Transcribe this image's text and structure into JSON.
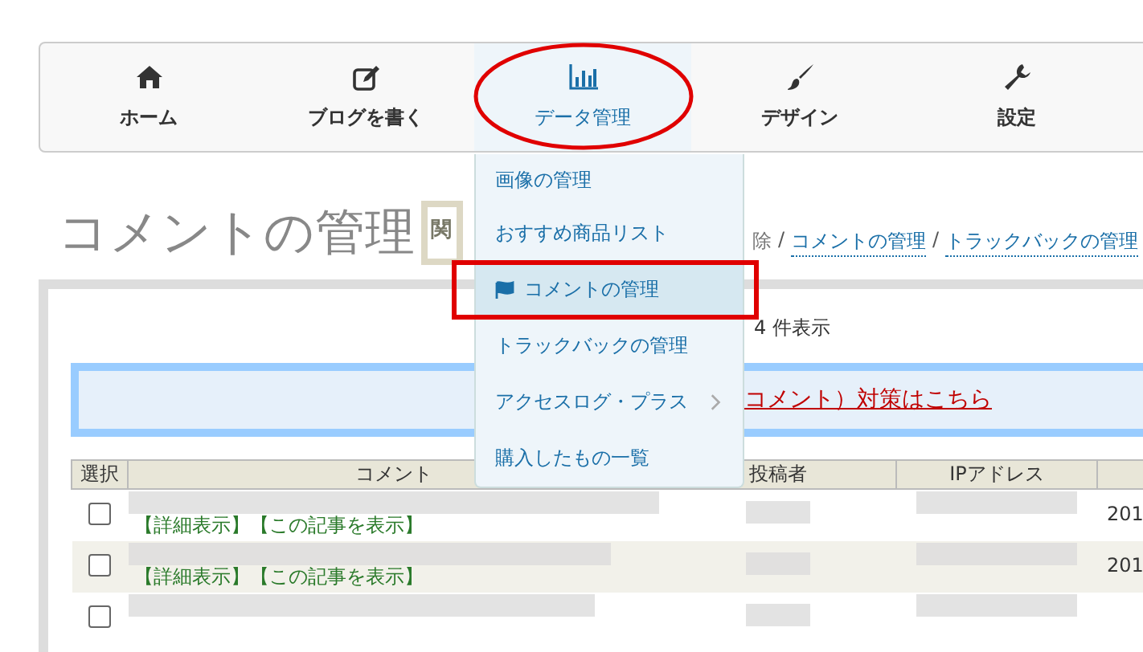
{
  "nav": {
    "items": [
      {
        "label": "ホーム",
        "selected": false
      },
      {
        "label": "ブログを書く",
        "selected": false
      },
      {
        "label": "データ管理",
        "selected": true
      },
      {
        "label": "デザイン",
        "selected": false
      },
      {
        "label": "設定",
        "selected": false
      }
    ]
  },
  "dropdown": {
    "items": [
      {
        "label": "画像の管理",
        "selected": false,
        "has_submenu": false
      },
      {
        "label": "おすすめ商品リスト",
        "selected": false,
        "has_submenu": false
      },
      {
        "label": "コメントの管理",
        "selected": true,
        "has_submenu": false
      },
      {
        "label": "トラックバックの管理",
        "selected": false,
        "has_submenu": false
      },
      {
        "label": "アクセスログ・プラス",
        "selected": false,
        "has_submenu": true
      },
      {
        "label": "購入したもの一覧",
        "selected": false,
        "has_submenu": false
      }
    ]
  },
  "page_title": "コメントの管理",
  "related_box": "関",
  "breadcrumb": [
    {
      "kind": "text",
      "label": "除"
    },
    {
      "kind": "separator",
      "label": "/"
    },
    {
      "kind": "link",
      "label": "コメントの管理"
    },
    {
      "kind": "separator",
      "label": "/"
    },
    {
      "kind": "link",
      "label": "トラックバックの管理"
    }
  ],
  "count_text": "4 件表示",
  "notice_link": "コメント）対策はこちら",
  "table": {
    "columns": [
      "選択",
      "コメント",
      "投稿者",
      "IPアドレス"
    ],
    "rows": [
      {
        "checked": false,
        "links": [
          "【詳細表示】",
          "【この記事を表示】"
        ],
        "date": "201"
      },
      {
        "checked": false,
        "links": [
          "【詳細表示】",
          "【この記事を表示】"
        ],
        "date": "201"
      },
      {
        "checked": false,
        "links": [],
        "date": ""
      }
    ]
  }
}
